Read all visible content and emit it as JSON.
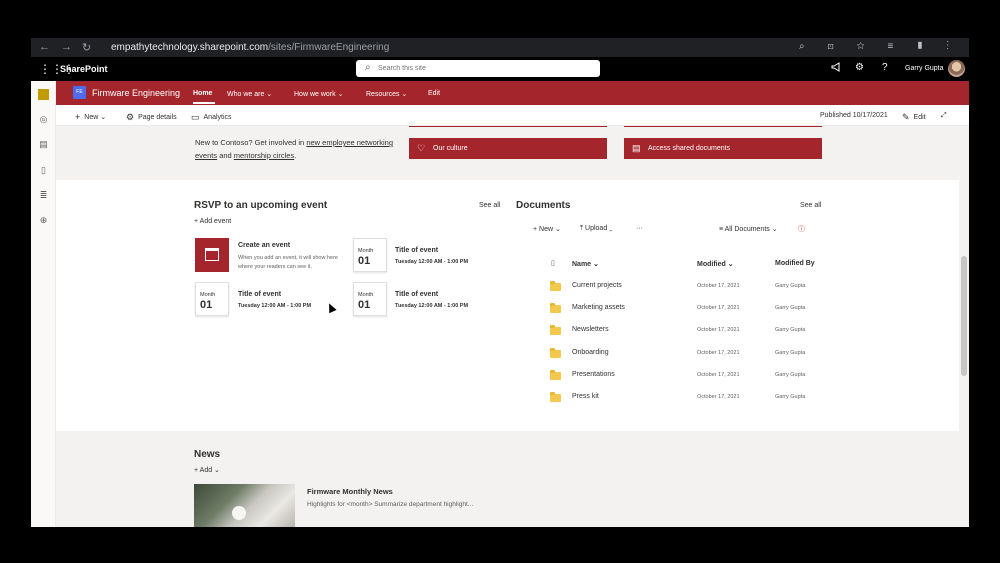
{
  "browser": {
    "url_domain": "empathytechnology.sharepoint.com",
    "url_path": "/sites/FirmwareEngineering",
    "back": "←",
    "forward": "→",
    "reload": "↻",
    "icons": "⌕ ⊡ ☆ ≡ ▮ ⋮"
  },
  "suite": {
    "waffle": "⋮⋮⋮",
    "app_name": "SharePoint",
    "search_icon": "⌕",
    "search_placeholder": "Search this site",
    "megaphone_icon": "📢",
    "settings_icon": "⚙",
    "help_icon": "?",
    "user_name": "Garry Gupta"
  },
  "hub": {
    "logo": "FE",
    "site_title": "Firmware Engineering",
    "links": [
      "Home",
      "Who we are ⌄",
      "How we work ⌄",
      "Resources ⌄",
      "Edit"
    ]
  },
  "command_bar": {
    "new": "New ⌄",
    "page_details": "Page details",
    "analytics": "Analytics",
    "published": "Published 10/17/2021",
    "edit": "Edit",
    "expand": "⤢"
  },
  "welcome": {
    "text_1": "New to Contoso? Get involved in ",
    "link_1": "new employee networking events",
    "text_2": " and ",
    "link_2": "mentorship circles",
    "text_3": "."
  },
  "quick_links": [
    {
      "label": "Our culture",
      "icon": "♡"
    },
    {
      "label": "Access shared documents",
      "icon": "▤"
    }
  ],
  "events": {
    "title": "RSVP to an upcoming event",
    "see_all": "See all",
    "add": "+ Add event",
    "create": {
      "title": "Create an event",
      "desc": "When you add an event, it will show here where your readers can see it."
    },
    "items": [
      {
        "month": "Month",
        "day": "01",
        "title": "Title of event",
        "time": "Tuesday 12:00 AM - 1:00 PM"
      },
      {
        "month": "Month",
        "day": "01",
        "title": "Title of event",
        "time": "Tuesday 12:00 AM - 1:00 PM"
      },
      {
        "month": "Month",
        "day": "01",
        "title": "Title of event",
        "time": "Tuesday 12:00 AM - 1:00 PM"
      }
    ]
  },
  "documents": {
    "title": "Documents",
    "see_all": "See all",
    "new": "+ New ⌄",
    "upload": "⤒ Upload ⌄",
    "more": "···",
    "view": "≡ All Documents ⌄",
    "info": "ⓘ",
    "columns": {
      "name": "Name ⌄",
      "modified": "Modified ⌄",
      "modified_by": "Modified By"
    },
    "rows": [
      {
        "name": "Current projects",
        "modified": "October 17, 2021",
        "by": "Garry Gupta"
      },
      {
        "name": "Marketing assets",
        "modified": "October 17, 2021",
        "by": "Garry Gupta"
      },
      {
        "name": "Newsletters",
        "modified": "October 17, 2021",
        "by": "Garry Gupta"
      },
      {
        "name": "Onboarding",
        "modified": "October 17, 2021",
        "by": "Garry Gupta"
      },
      {
        "name": "Presentations",
        "modified": "October 17, 2021",
        "by": "Garry Gupta"
      },
      {
        "name": "Press kit",
        "modified": "October 17, 2021",
        "by": "Garry Gupta"
      }
    ]
  },
  "news": {
    "title": "News",
    "add": "+ Add ⌄",
    "item_title": "Firmware Monthly News",
    "item_desc": "Highlights for <month> Summarize department highlight..."
  }
}
